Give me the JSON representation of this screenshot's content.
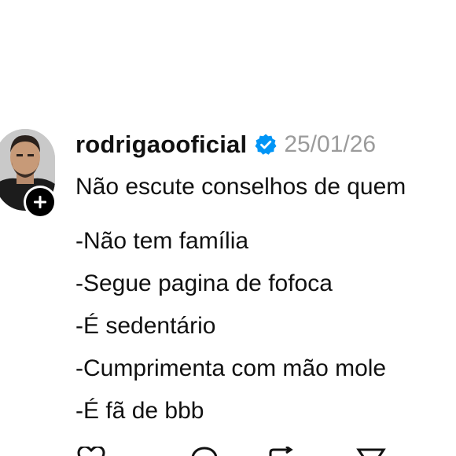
{
  "post": {
    "username": "rodrigaooficial",
    "timestamp": "25/01/26",
    "lines": [
      "Não escute conselhos de quem",
      "-Não tem família",
      "-Segue pagina de fofoca",
      "-É sedentário",
      "-Cumprimenta com mão mole",
      "-É fã de bbb"
    ]
  },
  "icons": {
    "verified": "verified-badge-icon",
    "follow": "plus-icon",
    "actions": [
      "heart-icon",
      "comment-icon",
      "repost-icon",
      "share-icon"
    ]
  },
  "colors": {
    "text": "#111111",
    "timestamp": "#9b9b9b",
    "verified": "#0095f6",
    "background": "#ffffff"
  }
}
